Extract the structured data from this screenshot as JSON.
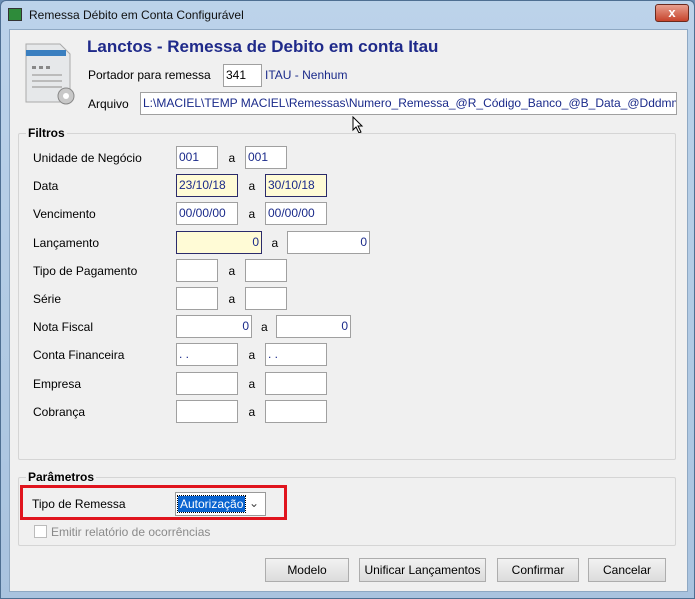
{
  "window": {
    "title": "Remessa Débito em Conta Configurável",
    "close": "x"
  },
  "header": {
    "title": "Lanctos - Remessa de Debito em conta Itau",
    "portador_label": "Portador para remessa",
    "portador_value": "341",
    "portador_name": "ITAU - Nenhum",
    "arquivo_label": "Arquivo",
    "arquivo_value": "L:\\MACIEL\\TEMP MACIEL\\Remessas\\Numero_Remessa_@R_Código_Banco_@B_Data_@Dddmmaa@_I"
  },
  "filtros": {
    "title": "Filtros",
    "sep": "a",
    "rows": [
      {
        "label": "Unidade de Negócio",
        "from": "001",
        "to": "001"
      },
      {
        "label": "Data",
        "from": "23/10/18",
        "to": "30/10/18"
      },
      {
        "label": "Vencimento",
        "from": "00/00/00",
        "to": "00/00/00"
      },
      {
        "label": "Lançamento",
        "from": "0",
        "to": "0"
      },
      {
        "label": "Tipo de Pagamento",
        "from": "",
        "to": ""
      },
      {
        "label": "Série",
        "from": "",
        "to": ""
      },
      {
        "label": "Nota Fiscal",
        "from": "0",
        "to": "0"
      },
      {
        "label": "Conta Financeira",
        "from": " .  .",
        "to": " .  ."
      },
      {
        "label": "Empresa",
        "from": "",
        "to": ""
      },
      {
        "label": "Cobrança",
        "from": "",
        "to": ""
      }
    ]
  },
  "parametros": {
    "title": "Parâmetros",
    "tipo_label": "Tipo de Remessa",
    "tipo_value": "Autorização",
    "checkbox_label": "Emitir relatório de ocorrências",
    "checkbox_checked": false,
    "highlight_color": "#e0141e"
  },
  "buttons": {
    "modelo": "Modelo",
    "unificar": "Unificar Lançamentos",
    "confirmar": "Confirmar",
    "cancelar": "Cancelar"
  }
}
